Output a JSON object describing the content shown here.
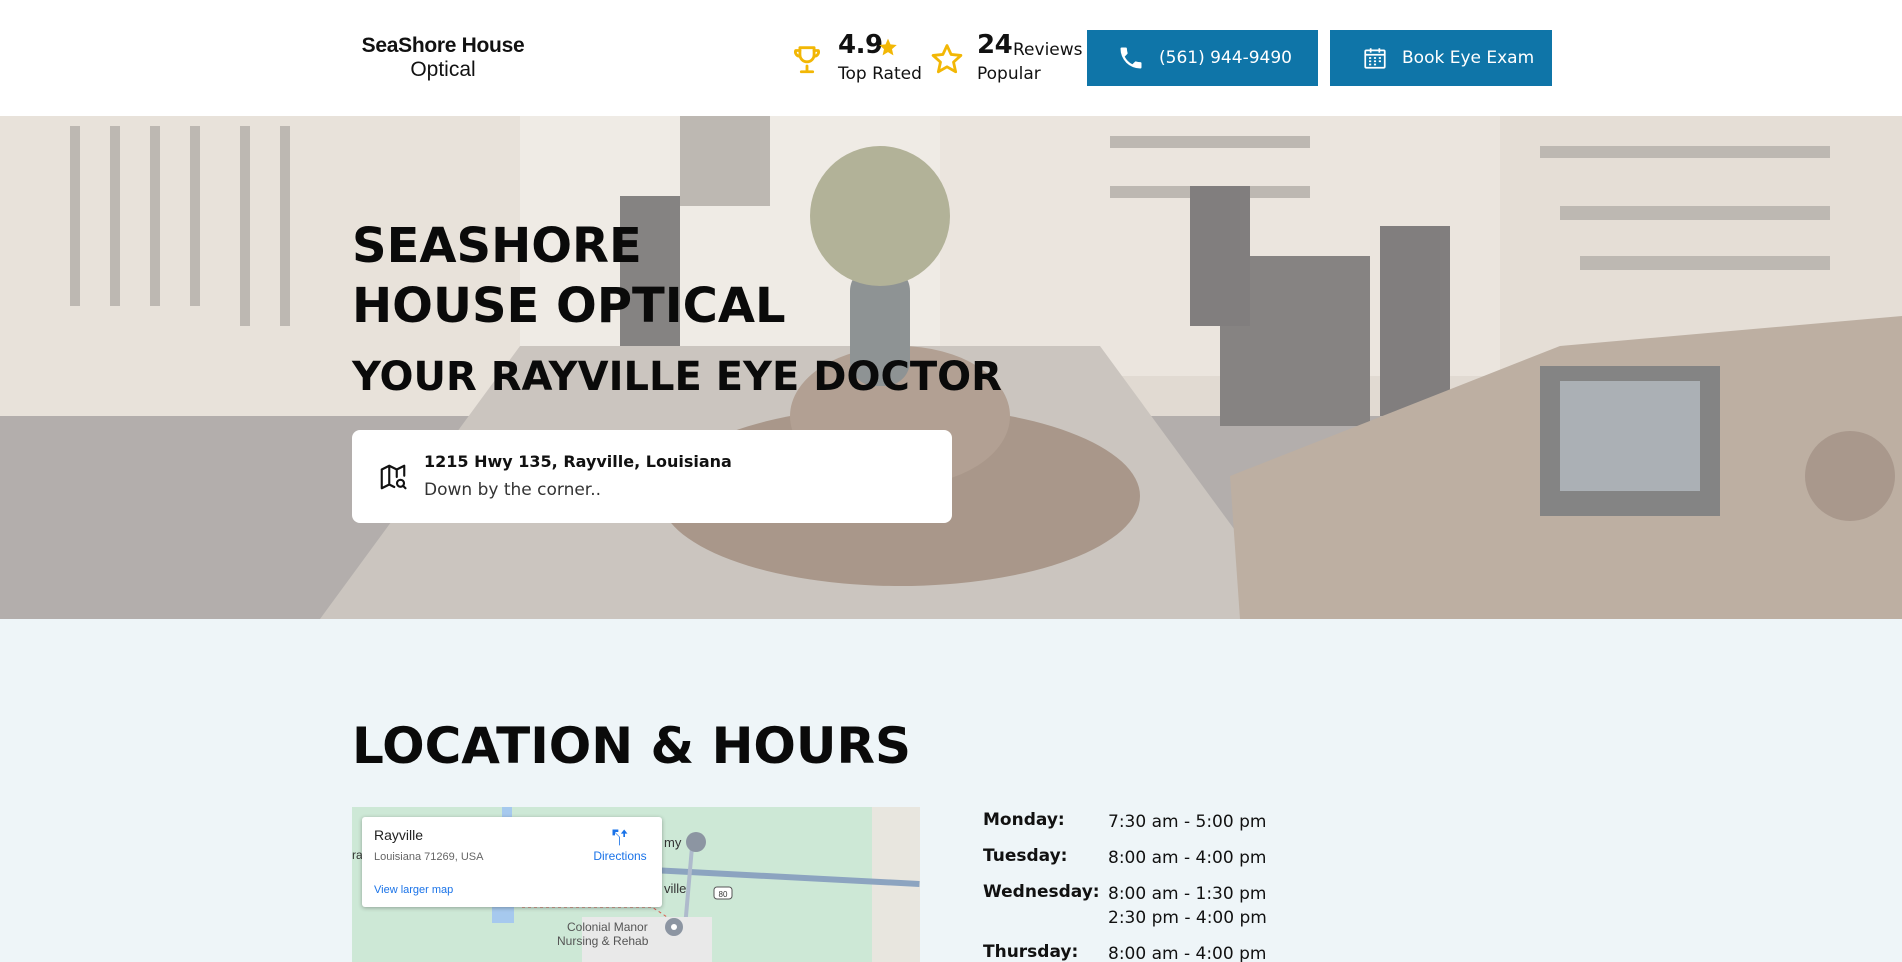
{
  "header": {
    "logo_line1": "SeaShore House",
    "logo_line2": "Optical",
    "rating_value": "4.9",
    "rating_label": "Top Rated",
    "reviews_count": "24",
    "reviews_word": "Reviews",
    "reviews_label": "Popular",
    "phone_button": "(561) 944-9490",
    "book_button": "Book Eye Exam",
    "accent_color": "#0f75a8",
    "icon_color": "#f2b705"
  },
  "hero": {
    "title_line1": "SEASHORE",
    "title_line2": "HOUSE OPTICAL",
    "subtitle": "YOUR RAYVILLE EYE DOCTOR",
    "address": "1215 Hwy 135, Rayville, Louisiana",
    "address_note": "Down by the corner.."
  },
  "location": {
    "title": "LOCATION & HOURS",
    "map": {
      "place_name": "Rayville",
      "place_address": "Louisiana 71269, USA",
      "directions_label": "Directions",
      "larger_map_label": "View larger map",
      "poi_label_line1": "Colonial Manor",
      "poi_label_line2": "Nursing & Rehab",
      "road_label": "80",
      "town_fragment_1": "ville",
      "town_fragment_2": "my",
      "edge_fragment": "ra"
    },
    "hours": [
      {
        "day": "Monday:",
        "times": [
          "7:30 am - 5:00 pm"
        ]
      },
      {
        "day": "Tuesday:",
        "times": [
          "8:00 am - 4:00 pm"
        ]
      },
      {
        "day": "Wednesday:",
        "times": [
          "8:00 am - 1:30 pm",
          "2:30 pm - 4:00 pm"
        ]
      },
      {
        "day": "Thursday:",
        "times": [
          "8:00 am - 4:00 pm"
        ]
      }
    ]
  }
}
